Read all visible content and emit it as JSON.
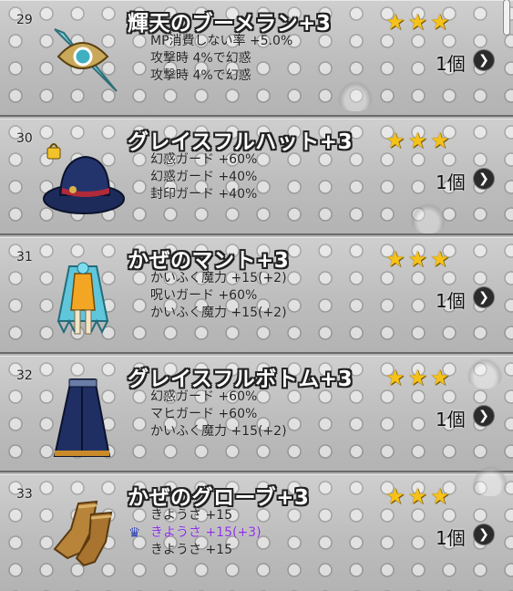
{
  "items": [
    {
      "number": "29",
      "name": "輝天のブーメラン+3",
      "stars": [
        "★",
        "★",
        "★"
      ],
      "stats": [
        "MP消費しない率 +5.0%",
        "攻撃時 4%で幻惑",
        "攻撃時 4%で幻惑"
      ],
      "quantity": "1個",
      "icon": "boomerang-icon"
    },
    {
      "number": "30",
      "name": "グレイスフルハット+3",
      "stars": [
        "★",
        "★",
        "★"
      ],
      "stats": [
        "幻惑ガード +60%",
        "幻惑ガード +40%",
        "封印ガード +40%"
      ],
      "quantity": "1個",
      "icon": "hat-icon",
      "locked": true
    },
    {
      "number": "31",
      "name": "かぜのマント+3",
      "stars": [
        "★",
        "★",
        "★"
      ],
      "stats": [
        "かいふく魔力 +15(+2)",
        "呪いガード +60%",
        "かいふく魔力 +15(+2)"
      ],
      "quantity": "1個",
      "icon": "cloak-icon"
    },
    {
      "number": "32",
      "name": "グレイスフルボトム+3",
      "stars": [
        "★",
        "★",
        "★"
      ],
      "stats": [
        "幻惑ガード +60%",
        "マヒガード +60%",
        "かいふく魔力 +15(+2)"
      ],
      "quantity": "1個",
      "icon": "skirt-icon"
    },
    {
      "number": "33",
      "name": "かぜのグローブ+3",
      "stars": [
        "★",
        "★",
        "★"
      ],
      "stats": [
        "きようさ +15",
        "きようさ +15(+3)",
        "きようさ +15"
      ],
      "highlight_stat_index": 1,
      "quantity": "1個",
      "icon": "gloves-icon"
    }
  ],
  "colors": {
    "star": "#f6c21a",
    "title_outline": "#222222",
    "highlight_stat": "#8a2be2"
  }
}
